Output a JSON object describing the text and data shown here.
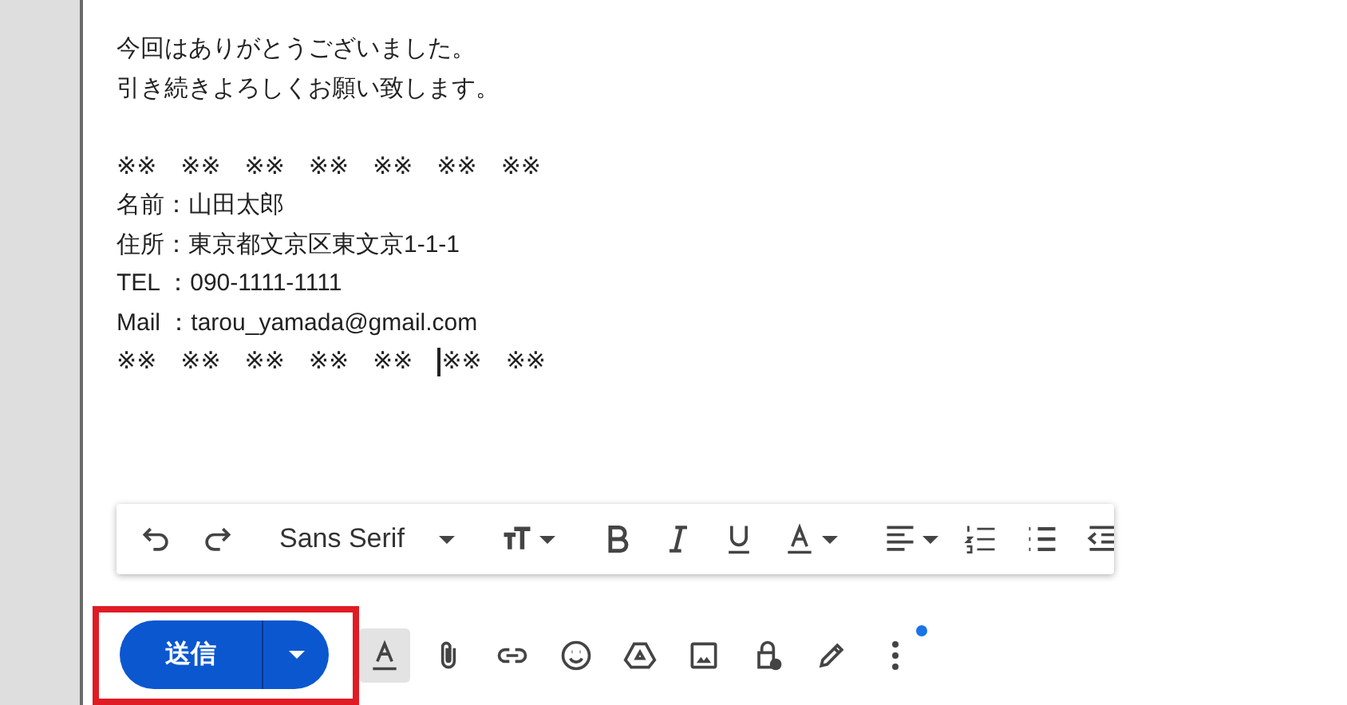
{
  "message_body": {
    "paragraphs": [
      [
        {
          "text": "今回はありがとうございました。"
        },
        {
          "text": "引き続きよろしくお願い致します。"
        }
      ],
      [
        {
          "text": "※※　※※　※※　※※　※※　※※　※※"
        },
        {
          "text": "名前：山田太郎"
        },
        {
          "text": "住所：東京都文京区東文京1-1-1"
        },
        {
          "text": "TEL ：090-1111-1111"
        },
        {
          "text": "Mail ：tarou_yamada@gmail.com"
        }
      ]
    ],
    "cursor_line": {
      "before_cursor": "※※　※※　※※　※※　※※　",
      "after_cursor": "※※　※※"
    }
  },
  "format_toolbar": {
    "font": "Sans Serif",
    "items": [
      {
        "kind": "undo"
      },
      {
        "kind": "redo"
      },
      {
        "kind": "divider"
      },
      {
        "kind": "font"
      },
      {
        "kind": "divider"
      },
      {
        "kind": "size"
      },
      {
        "kind": "divider"
      },
      {
        "kind": "bold"
      },
      {
        "kind": "italic"
      },
      {
        "kind": "underline"
      },
      {
        "kind": "textcolor"
      },
      {
        "kind": "divider"
      },
      {
        "kind": "align"
      },
      {
        "kind": "numbered"
      },
      {
        "kind": "bullets"
      },
      {
        "kind": "outdent"
      }
    ]
  },
  "compose_actions": {
    "send_label": "送信",
    "highlighted": true,
    "items": [
      {
        "kind": "format",
        "selected": true
      },
      {
        "kind": "attach",
        "selected": false
      },
      {
        "kind": "link",
        "selected": false
      },
      {
        "kind": "emoji",
        "selected": false
      },
      {
        "kind": "drive",
        "selected": false
      },
      {
        "kind": "photo",
        "selected": false
      },
      {
        "kind": "lock",
        "selected": false
      },
      {
        "kind": "signature",
        "selected": false
      },
      {
        "kind": "more",
        "selected": false,
        "badge": true
      }
    ]
  }
}
